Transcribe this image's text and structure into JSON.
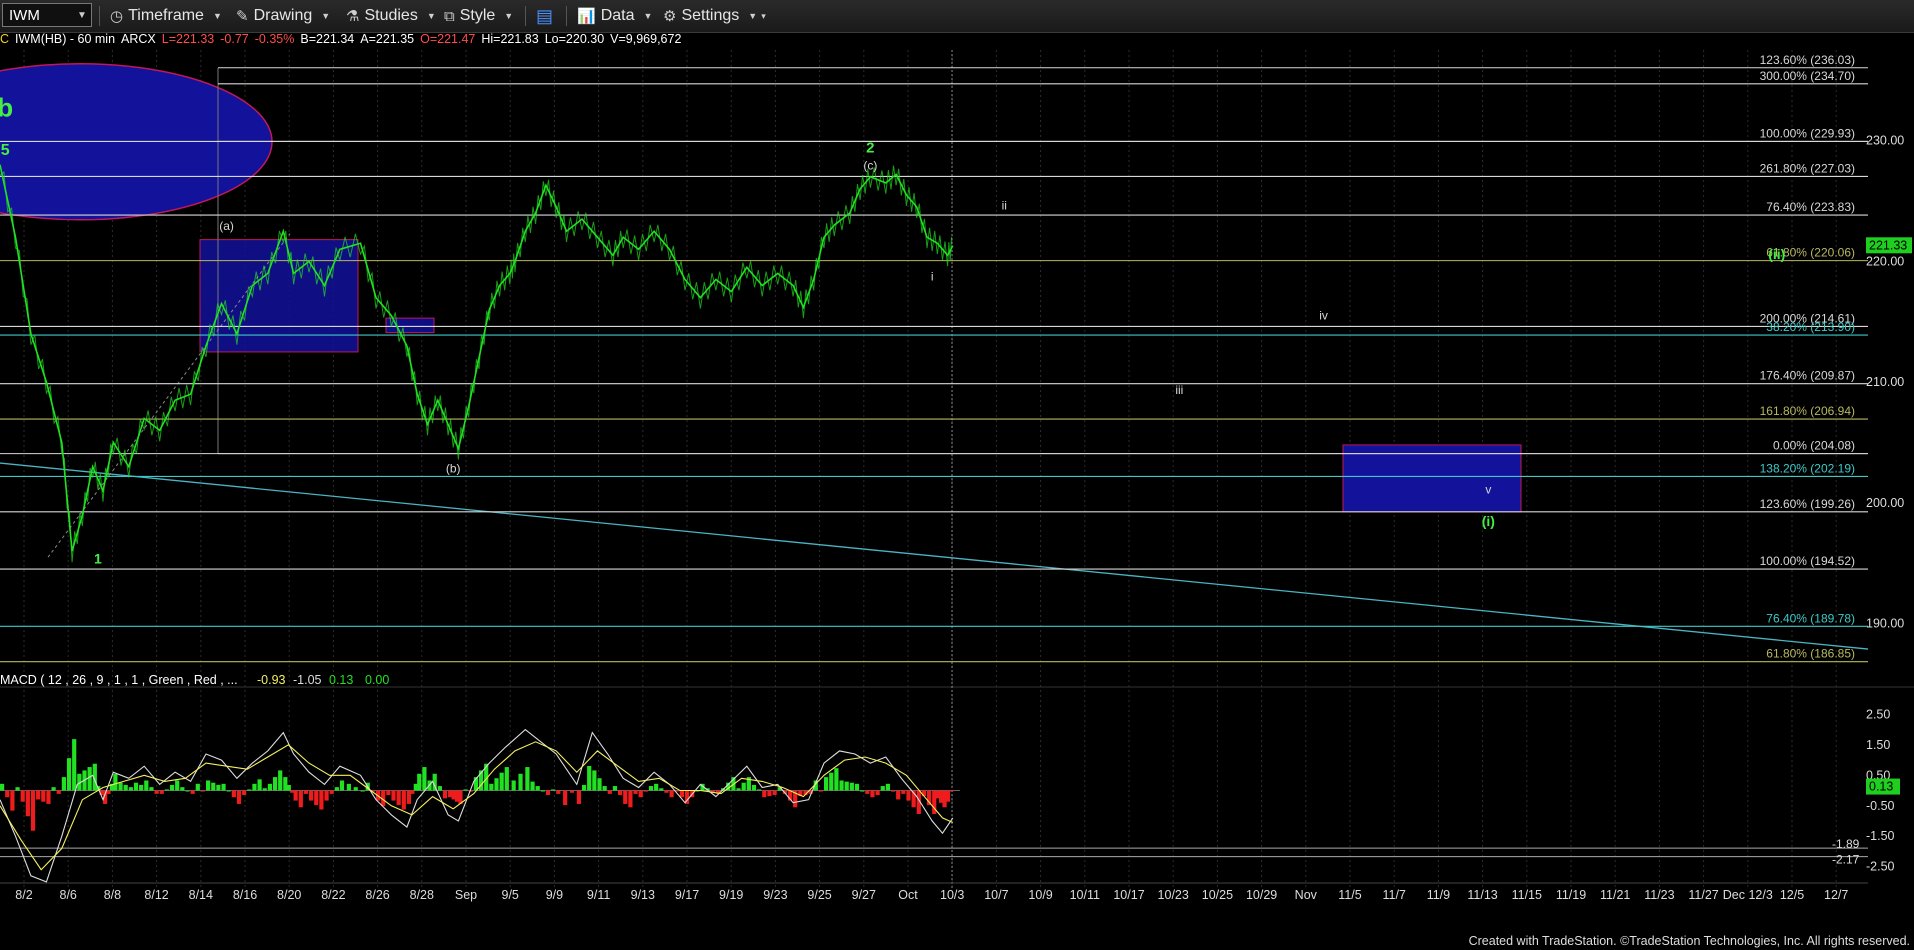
{
  "toolbar": {
    "symbol": "IWM",
    "items": [
      {
        "label": "Timeframe",
        "icon": "clock-icon"
      },
      {
        "label": "Drawing",
        "icon": "pencil-icon"
      },
      {
        "label": "Studies",
        "icon": "flask-icon"
      },
      {
        "label": "Style",
        "icon": "style-icon"
      },
      {
        "label": "",
        "icon": "layout-icon"
      },
      {
        "label": "Data",
        "icon": "bar-chart-icon"
      },
      {
        "label": "Settings",
        "icon": "gear-icon"
      }
    ]
  },
  "info_bar": {
    "prefix": "C",
    "symbol_desc": "IWM(HB) - 60 min",
    "exchange": "ARCX",
    "last": "L=221.33",
    "change": "-0.77",
    "change_pct": "-0.35%",
    "bid": "B=221.34",
    "ask": "A=221.35",
    "open": "O=221.47",
    "high": "Hi=221.83",
    "low": "Lo=220.30",
    "volume": "V=9,969,672"
  },
  "colors": {
    "price": "#22e022",
    "up": "#22e022",
    "down": "#ee1c1c",
    "signal": "#f5f060",
    "fib_white": "#d8d8d8",
    "fib_olive": "#b8b860",
    "fib_teal": "#3ec8c8",
    "box_fill": "#12129a",
    "box_border": "#c0185a",
    "label_green": "#44ee44"
  },
  "chart_data": {
    "type": "line",
    "x_tick_labels": [
      "8/2",
      "8/6",
      "8/8",
      "8/12",
      "8/14",
      "8/16",
      "8/20",
      "8/22",
      "8/26",
      "8/28",
      "Sep",
      "9/5",
      "9/9",
      "9/11",
      "9/13",
      "9/17",
      "9/19",
      "9/23",
      "9/25",
      "9/27",
      "Oct",
      "10/3",
      "10/7",
      "10/9",
      "10/11",
      "10/17",
      "10/23",
      "10/25",
      "10/29",
      "Nov",
      "11/5",
      "11/7",
      "11/9",
      "11/13",
      "11/15",
      "11/19",
      "11/21",
      "11/23",
      "11/27",
      "Dec 12/3",
      "12/5",
      "12/7"
    ],
    "y_ticks": [
      190,
      200,
      210,
      220,
      230
    ],
    "ylim": [
      186,
      237.5
    ],
    "last_price_label": "221.33",
    "price_path": [
      [
        0,
        228
      ],
      [
        3,
        222
      ],
      [
        6,
        214
      ],
      [
        9,
        210
      ],
      [
        12,
        205
      ],
      [
        14,
        196
      ],
      [
        16,
        199
      ],
      [
        18,
        203
      ],
      [
        20,
        201
      ],
      [
        22,
        205
      ],
      [
        25,
        203
      ],
      [
        28,
        207
      ],
      [
        31,
        206
      ],
      [
        34,
        208.5
      ],
      [
        37,
        209
      ],
      [
        40,
        213
      ],
      [
        43,
        216.5
      ],
      [
        46,
        214
      ],
      [
        49,
        218
      ],
      [
        52,
        219
      ],
      [
        55,
        222.5
      ],
      [
        57,
        219
      ],
      [
        60,
        220
      ],
      [
        63,
        218
      ],
      [
        66,
        221
      ],
      [
        70,
        221.5
      ],
      [
        73,
        217
      ],
      [
        76,
        215.5
      ],
      [
        79,
        213
      ],
      [
        81,
        209
      ],
      [
        83,
        206.5
      ],
      [
        85,
        208.5
      ],
      [
        87,
        206.5
      ],
      [
        89,
        204.5
      ],
      [
        91,
        208
      ],
      [
        93,
        212
      ],
      [
        95,
        216
      ],
      [
        97,
        218
      ],
      [
        99,
        219
      ],
      [
        100,
        220
      ],
      [
        102,
        222.5
      ],
      [
        104,
        224
      ],
      [
        106,
        226.3
      ],
      [
        108,
        224.5
      ],
      [
        110,
        222.5
      ],
      [
        113,
        223.5
      ],
      [
        116,
        222
      ],
      [
        119,
        220.5
      ],
      [
        121,
        222
      ],
      [
        124,
        221
      ],
      [
        127,
        222.5
      ],
      [
        130,
        221
      ],
      [
        133,
        218.5
      ],
      [
        136,
        217
      ],
      [
        139,
        218.5
      ],
      [
        142,
        217.5
      ],
      [
        145,
        219.5
      ],
      [
        148,
        218
      ],
      [
        151,
        219
      ],
      [
        154,
        218
      ],
      [
        156,
        216.2
      ],
      [
        158,
        218.5
      ],
      [
        160,
        222
      ],
      [
        162,
        223
      ],
      [
        165,
        224
      ],
      [
        167,
        226
      ],
      [
        169,
        227
      ],
      [
        172,
        226.5
      ],
      [
        174,
        227.2
      ],
      [
        176,
        225.5
      ],
      [
        178,
        224.5
      ],
      [
        180,
        222
      ],
      [
        182,
        221.5
      ],
      [
        184,
        220.5
      ],
      [
        185,
        221.3
      ]
    ],
    "fib_levels": [
      {
        "label": "123.60% (236.03)",
        "value": 236.03,
        "color": "fib_white"
      },
      {
        "label": "300.00% (234.70)",
        "value": 234.7,
        "color": "fib_white"
      },
      {
        "label": "100.00% (229.93)",
        "value": 229.93,
        "color": "fib_white"
      },
      {
        "label": "261.80% (227.03)",
        "value": 227.03,
        "color": "fib_white"
      },
      {
        "label": "76.40% (223.83)",
        "value": 223.83,
        "color": "fib_white"
      },
      {
        "label": "61.80% (220.06)",
        "value": 220.06,
        "color": "fib_olive"
      },
      {
        "label": "200.00% (214.61)",
        "value": 214.61,
        "color": "fib_white"
      },
      {
        "label": "38.20% (213.90)",
        "value": 213.9,
        "color": "fib_teal"
      },
      {
        "label": "176.40% (209.87)",
        "value": 209.87,
        "color": "fib_white"
      },
      {
        "label": "161.80% (206.94)",
        "value": 206.94,
        "color": "fib_olive"
      },
      {
        "label": "0.00% (204.08)",
        "value": 204.08,
        "color": "fib_white"
      },
      {
        "label": "138.20% (202.19)",
        "value": 202.19,
        "color": "fib_teal"
      },
      {
        "label": "123.60% (199.26)",
        "value": 199.26,
        "color": "fib_white"
      },
      {
        "label": "100.00% (194.52)",
        "value": 194.52,
        "color": "fib_white"
      },
      {
        "label": "76.40% (189.78)",
        "value": 189.78,
        "color": "fib_teal"
      },
      {
        "label": "61.80% (186.85)",
        "value": 186.85,
        "color": "fib_olive"
      }
    ],
    "wave_labels": [
      {
        "text": "b",
        "x": 1,
        "y": 232,
        "color": "label_green",
        "size": 26,
        "bold": true
      },
      {
        "text": "5",
        "x": 1,
        "y": 228.8,
        "color": "label_green",
        "size": 16,
        "bold": true
      },
      {
        "text": "1",
        "x": 19,
        "y": 195,
        "color": "label_green",
        "size": 14,
        "bold": true
      },
      {
        "text": "(a)",
        "x": 44,
        "y": 222.6,
        "color": "fib_white",
        "size": 12
      },
      {
        "text": "(b)",
        "x": 88,
        "y": 202.5,
        "color": "fib_white",
        "size": 12
      },
      {
        "text": "2",
        "x": 169,
        "y": 229,
        "color": "label_green",
        "size": 15,
        "bold": true
      },
      {
        "text": "(c)",
        "x": 169,
        "y": 227.6,
        "color": "fib_white",
        "size": 12
      },
      {
        "text": "i",
        "x": 181,
        "y": 218.4,
        "color": "fib_white",
        "size": 12
      },
      {
        "text": "ii",
        "x": 195,
        "y": 224.3,
        "color": "fib_white",
        "size": 12
      },
      {
        "text": "iii",
        "x": 229,
        "y": 209,
        "color": "fib_white",
        "size": 12
      },
      {
        "text": "iv",
        "x": 257,
        "y": 215.2,
        "color": "fib_white",
        "size": 12
      },
      {
        "text": "v",
        "x": 289,
        "y": 200.8,
        "color": "fib_white",
        "size": 12
      },
      {
        "text": "(i)",
        "x": 289,
        "y": 198.1,
        "color": "label_green",
        "size": 14,
        "bold": true
      },
      {
        "text": "(ii)",
        "x": 345,
        "y": 220.2,
        "color": "label_green",
        "size": 14,
        "bold": true
      }
    ],
    "macd": {
      "title": "MACD ( 12 , 26 , 9 , 1 , 1 , Green , Red , ...",
      "values": [
        "-0.93",
        "-1.05",
        "0.13",
        "0.00"
      ],
      "y_ticks": [
        2.5,
        1.5,
        0.5,
        -0.5,
        -1.5,
        -2.5
      ],
      "ylim": [
        -3.2,
        3.3
      ],
      "last_value_label": "0.13",
      "extra_labels": [
        "-1.89",
        "-2.17"
      ],
      "macd_path": [
        [
          0,
          -0.3
        ],
        [
          3,
          -1.5
        ],
        [
          6,
          -2.8
        ],
        [
          9,
          -3.0
        ],
        [
          12,
          -1.5
        ],
        [
          15,
          0.2
        ],
        [
          18,
          0.5
        ],
        [
          20,
          -0.3
        ],
        [
          22,
          0.6
        ],
        [
          25,
          0.4
        ],
        [
          28,
          0.8
        ],
        [
          31,
          0.2
        ],
        [
          34,
          0.6
        ],
        [
          37,
          0.3
        ],
        [
          40,
          1.2
        ],
        [
          43,
          1.0
        ],
        [
          46,
          0.4
        ],
        [
          49,
          0.9
        ],
        [
          52,
          1.3
        ],
        [
          55,
          1.9
        ],
        [
          57,
          1.2
        ],
        [
          60,
          0.6
        ],
        [
          63,
          0.2
        ],
        [
          66,
          0.8
        ],
        [
          70,
          0.5
        ],
        [
          73,
          -0.3
        ],
        [
          76,
          -0.8
        ],
        [
          79,
          -1.2
        ],
        [
          81,
          -0.3
        ],
        [
          84,
          0.3
        ],
        [
          87,
          -0.8
        ],
        [
          89,
          -1.0
        ],
        [
          92,
          0.3
        ],
        [
          95,
          0.9
        ],
        [
          98,
          1.4
        ],
        [
          102,
          2.0
        ],
        [
          105,
          1.6
        ],
        [
          108,
          1.2
        ],
        [
          112,
          0.2
        ],
        [
          115,
          1.9
        ],
        [
          118,
          1.2
        ],
        [
          121,
          0.4
        ],
        [
          124,
          0.1
        ],
        [
          127,
          0.6
        ],
        [
          130,
          0.2
        ],
        [
          133,
          -0.4
        ],
        [
          136,
          0.2
        ],
        [
          139,
          -0.2
        ],
        [
          142,
          0.3
        ],
        [
          145,
          0.8
        ],
        [
          148,
          0.1
        ],
        [
          151,
          0.2
        ],
        [
          154,
          -0.4
        ],
        [
          157,
          -0.3
        ],
        [
          160,
          0.9
        ],
        [
          163,
          1.3
        ],
        [
          166,
          1.2
        ],
        [
          169,
          0.9
        ],
        [
          172,
          1.1
        ],
        [
          175,
          0.4
        ],
        [
          178,
          -0.2
        ],
        [
          181,
          -1.0
        ],
        [
          183,
          -1.4
        ],
        [
          185,
          -0.9
        ]
      ],
      "signal_path": [
        [
          0,
          -0.5
        ],
        [
          4,
          -1.6
        ],
        [
          8,
          -2.6
        ],
        [
          12,
          -1.9
        ],
        [
          16,
          -0.3
        ],
        [
          20,
          0.1
        ],
        [
          24,
          0.3
        ],
        [
          28,
          0.5
        ],
        [
          32,
          0.3
        ],
        [
          36,
          0.4
        ],
        [
          40,
          0.9
        ],
        [
          44,
          0.8
        ],
        [
          48,
          0.7
        ],
        [
          52,
          1.1
        ],
        [
          56,
          1.5
        ],
        [
          60,
          0.9
        ],
        [
          64,
          0.5
        ],
        [
          68,
          0.5
        ],
        [
          72,
          0.0
        ],
        [
          76,
          -0.5
        ],
        [
          80,
          -0.8
        ],
        [
          84,
          -0.2
        ],
        [
          88,
          -0.6
        ],
        [
          92,
          -0.1
        ],
        [
          96,
          0.7
        ],
        [
          100,
          1.3
        ],
        [
          104,
          1.6
        ],
        [
          108,
          1.3
        ],
        [
          112,
          0.6
        ],
        [
          116,
          1.3
        ],
        [
          120,
          0.8
        ],
        [
          124,
          0.3
        ],
        [
          128,
          0.4
        ],
        [
          132,
          0.0
        ],
        [
          136,
          0.0
        ],
        [
          140,
          -0.1
        ],
        [
          144,
          0.4
        ],
        [
          148,
          0.3
        ],
        [
          152,
          0.1
        ],
        [
          156,
          -0.2
        ],
        [
          160,
          0.5
        ],
        [
          164,
          1.0
        ],
        [
          168,
          1.1
        ],
        [
          172,
          0.9
        ],
        [
          176,
          0.5
        ],
        [
          180,
          -0.3
        ],
        [
          183,
          -0.9
        ],
        [
          185,
          -1.05
        ]
      ]
    }
  },
  "footer": "Created with TradeStation. ©TradeStation Technologies, Inc. All rights reserved."
}
